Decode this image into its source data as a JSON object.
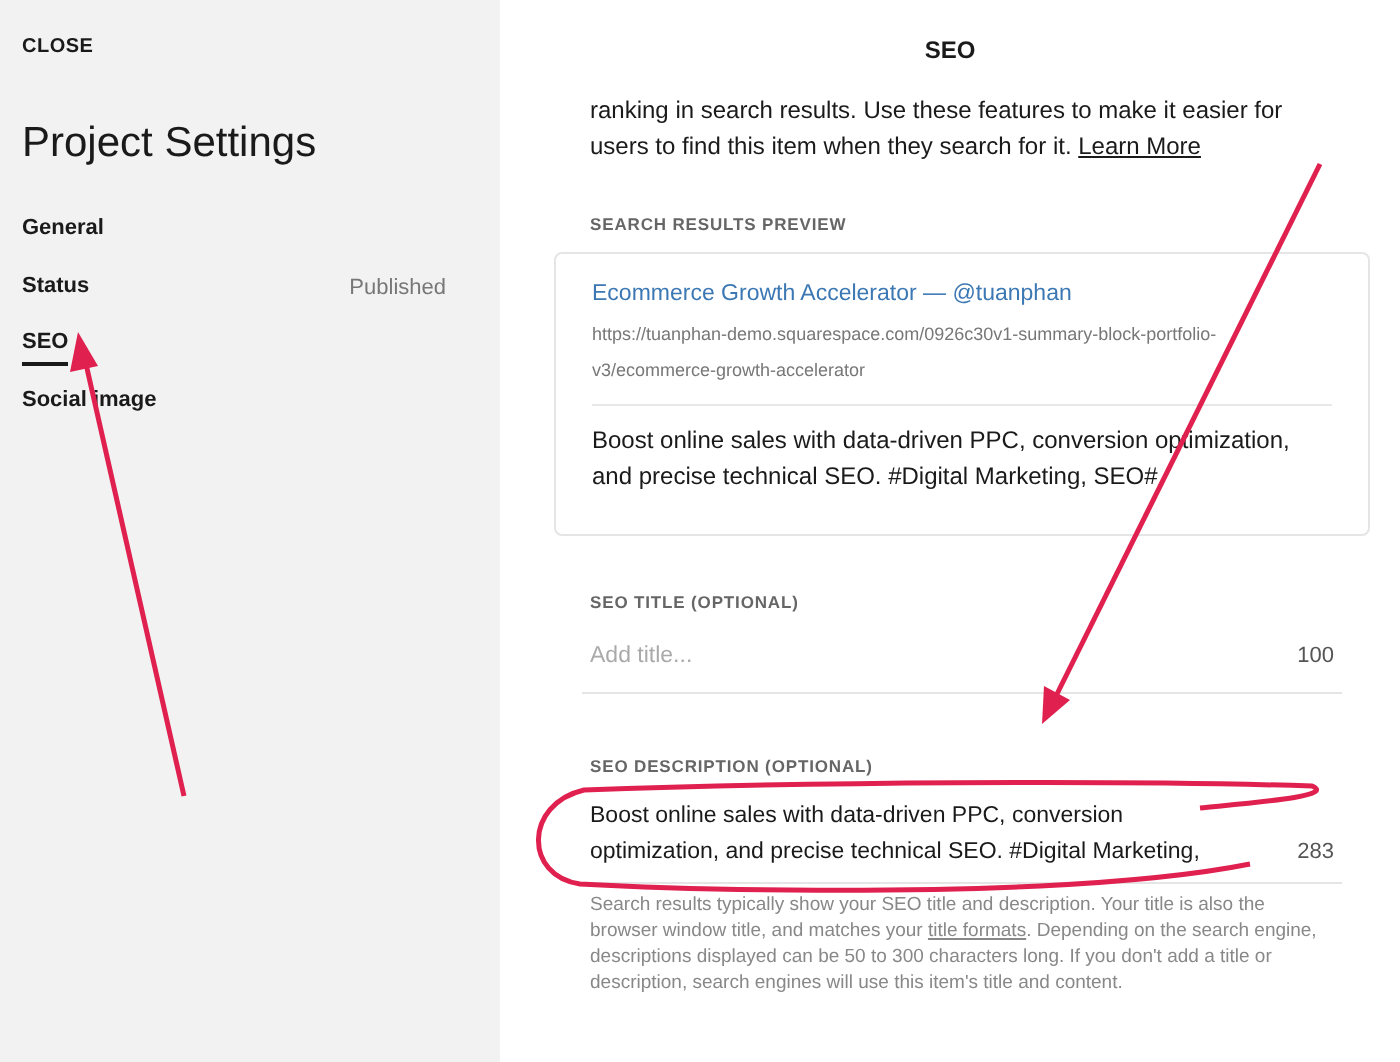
{
  "sidebar": {
    "close": "CLOSE",
    "title": "Project Settings",
    "items": [
      {
        "label": "General",
        "selected": false
      },
      {
        "label": "Status",
        "value": "Published",
        "selected": false
      },
      {
        "label": "SEO",
        "selected": true
      },
      {
        "label": "Social image",
        "selected": false
      }
    ]
  },
  "panel": {
    "title": "SEO",
    "intro": "ranking in search results. Use these features to make it easier for users to find this item when they search for it.",
    "intro_link": "Learn More",
    "preview": {
      "heading": "SEARCH RESULTS PREVIEW",
      "title": "Ecommerce Growth Accelerator — @tuanphan",
      "url": "https://tuanphan-demo.squarespace.com/0926c30v1-summary-block-portfolio-v3/ecommerce-growth-accelerator",
      "description": "Boost online sales with data-driven PPC, conversion optimization, and precise technical SEO. #Digital Marketing, SEO#"
    },
    "seo_title": {
      "label": "SEO TITLE (OPTIONAL)",
      "placeholder": "Add title...",
      "count": "100"
    },
    "seo_description": {
      "label": "SEO DESCRIPTION (OPTIONAL)",
      "value": "Boost online sales with data-driven PPC, conversion optimization, and precise technical SEO. #Digital Marketing,",
      "count": "283"
    },
    "help_before": "Search results typically show your SEO title and description. Your title is also the browser window title, and matches your",
    "help_link": "title formats",
    "help_after": ". Depending on the search engine, descriptions displayed can be 50 to 300 characters long. If you don't add a title or description, search engines will use this item's title and content."
  }
}
